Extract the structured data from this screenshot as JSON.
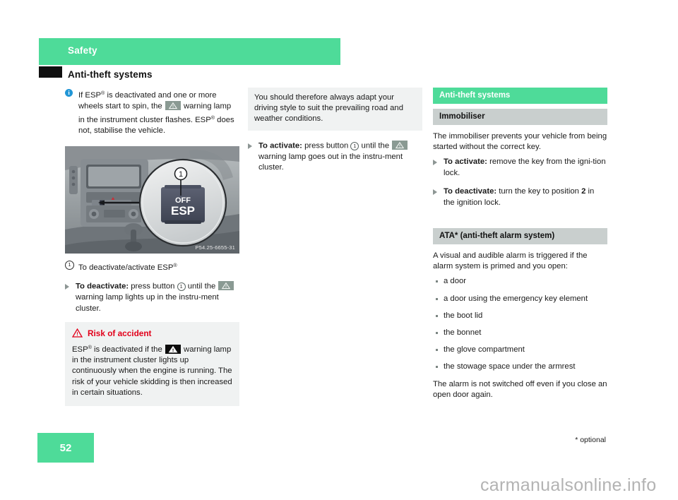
{
  "chapter": {
    "label": "Safety"
  },
  "page": {
    "title": "Anti-theft systems",
    "number": "52",
    "footnote": "* optional",
    "watermark": "carmanualsonline.info"
  },
  "left_column": {
    "info_note": {
      "icon": "info-circle-icon",
      "text_part1": "If ESP",
      "sup1": "®",
      "text_part2": " is deactivated and one or more wheels start to spin, the ",
      "lamp": "esp-warning-lamp-icon",
      "text_part3": " warning lamp in the instrument cluster flashes. ESP",
      "sup2": "®",
      "text_part4": " does not, stabilise the vehicle."
    },
    "figure": {
      "alt": "Centre console with ESP OFF button, magnified detail",
      "code": "P54.25-6655-31",
      "callout": "1",
      "button_label_top": "OFF",
      "button_label_main": "ESP"
    },
    "figure_caption": {
      "callout": "1",
      "text": "To deactivate/activate ESP",
      "sup": "®"
    },
    "action_deactivate": {
      "label": "To deactivate:",
      "text_part1": " press button ",
      "callout": "1",
      "text_part2": " until the ",
      "lamp": "esp-warning-lamp-icon",
      "text_part3": " warning lamp lights up in the instru-ment cluster."
    },
    "warning": {
      "icon": "red-warning-triangle-icon",
      "title": "Risk of accident",
      "body_part1": "ESP",
      "sup": "®",
      "body_part2": " is deactivated if the ",
      "lamp": "esp-warning-lamp-dark-icon",
      "body_part3": " warning lamp in the instrument cluster lights up continuously when the engine is running. The risk of your vehicle skidding is then increased in certain situations."
    }
  },
  "middle_column": {
    "shaded_paragraph": "You should therefore always adapt your driving style to suit the prevailing road and weather conditions.",
    "action_activate": {
      "label": "To activate:",
      "text_part1": " press button ",
      "callout": "1",
      "text_part2": " until the ",
      "lamp": "esp-warning-lamp-icon",
      "text_part3": " warning lamp goes out in the instru-ment cluster."
    }
  },
  "right_column": {
    "section_header": "Anti-theft systems",
    "immobiliser": {
      "header": "Immobiliser",
      "paragraph": "The immobiliser prevents your vehicle from being started without the correct key.",
      "action_activate": {
        "label": "To activate:",
        "text": " remove the key from the igni-tion lock."
      },
      "action_deactivate": {
        "label": "To deactivate:",
        "text_part1": " turn the key to position ",
        "bold_value": "2",
        "text_part2": " in the ignition lock."
      }
    },
    "ata": {
      "header": "ATA* (anti-theft alarm system)",
      "paragraph": "A visual and audible alarm is triggered if the alarm system is primed and you open:",
      "bullets": [
        "a door",
        "a door using the emergency key element",
        "the boot lid",
        "the bonnet",
        "the glove compartment",
        "the stowage space under the armrest"
      ],
      "closing_paragraph": "The alarm is not switched off even if you close an open door again."
    }
  },
  "colors": {
    "brand_green": "#4edb99",
    "header_gray": "#c9cfce",
    "shade_gray": "#f0f2f2",
    "warning_red": "#e2001a",
    "info_blue": "#2196d6"
  }
}
